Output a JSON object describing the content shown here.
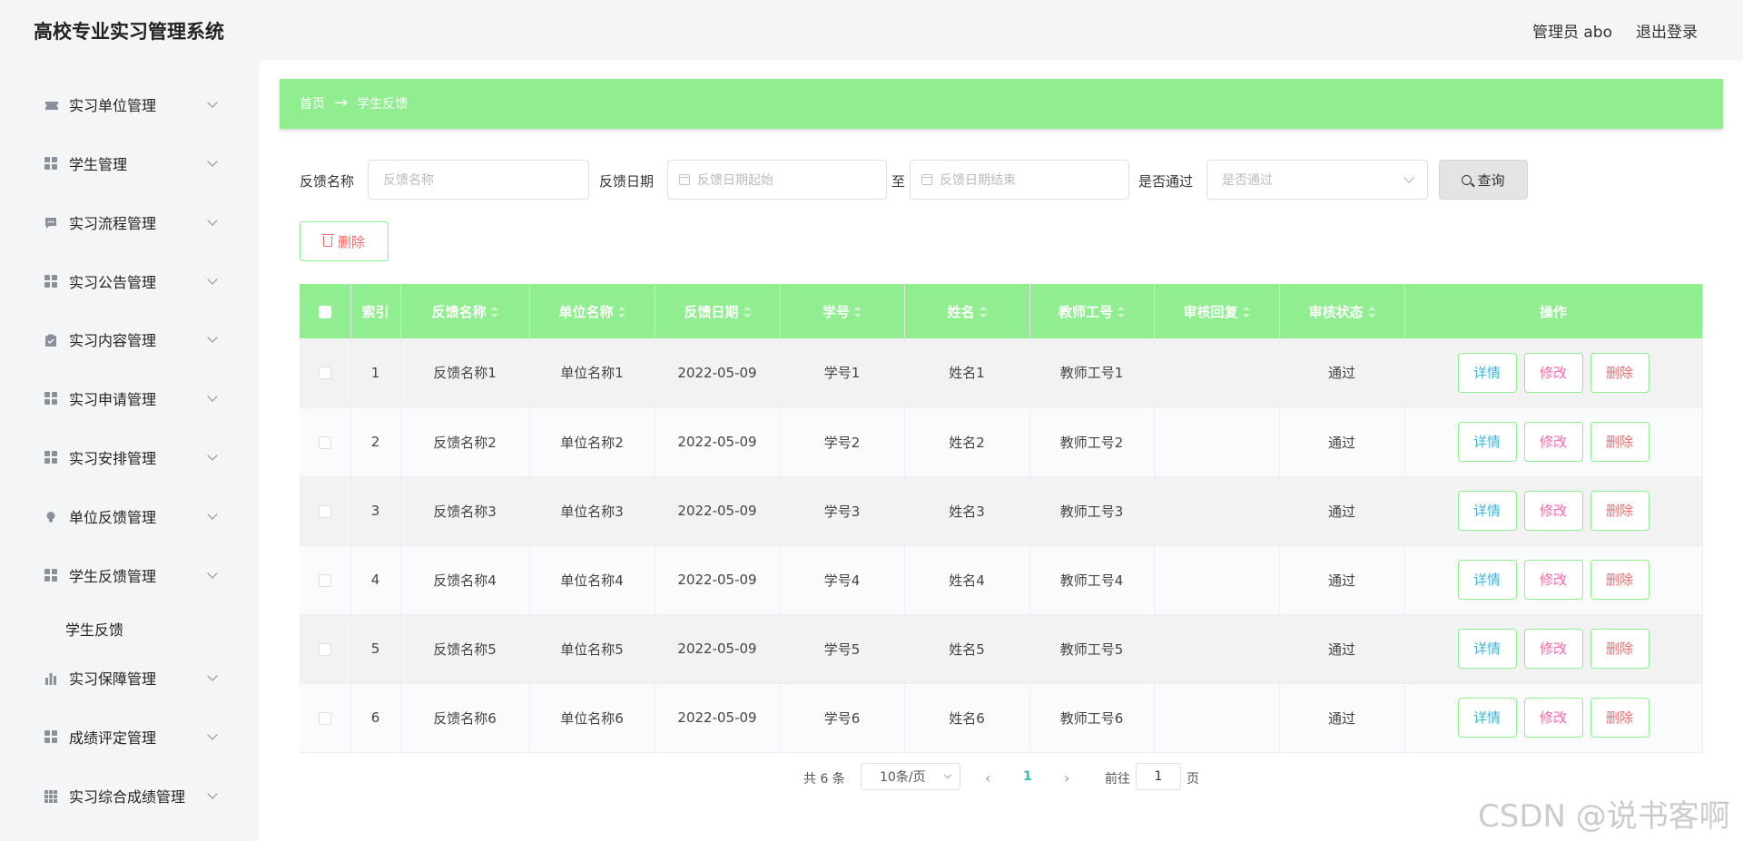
{
  "header": {
    "app_title": "高校专业实习管理系统",
    "user_label": "管理员 abo",
    "logout_label": "退出登录"
  },
  "sidebar": {
    "items": [
      {
        "label": "实习单位管理",
        "icon": "ticket-icon"
      },
      {
        "label": "学生管理",
        "icon": "grid-icon"
      },
      {
        "label": "实习流程管理",
        "icon": "chat-icon"
      },
      {
        "label": "实习公告管理",
        "icon": "grid-icon"
      },
      {
        "label": "实习内容管理",
        "icon": "clipboard-icon"
      },
      {
        "label": "实习申请管理",
        "icon": "grid-icon"
      },
      {
        "label": "实习安排管理",
        "icon": "grid-icon"
      },
      {
        "label": "单位反馈管理",
        "icon": "bulb-icon"
      },
      {
        "label": "学生反馈管理",
        "icon": "grid-icon"
      },
      {
        "label": "实习保障管理",
        "icon": "bar-chart-icon"
      },
      {
        "label": "成绩评定管理",
        "icon": "grid-icon"
      },
      {
        "label": "实习综合成绩管理",
        "icon": "grid-9-icon"
      }
    ],
    "sub_item": "学生反馈"
  },
  "breadcrumb": {
    "home": "首页",
    "arrow": "→",
    "current": "学生反馈"
  },
  "search": {
    "name_label": "反馈名称",
    "name_placeholder": "反馈名称",
    "date_label": "反馈日期",
    "date_start_placeholder": "反馈日期起始",
    "to_label": "至",
    "date_end_placeholder": "反馈日期结束",
    "pass_label": "是否通过",
    "pass_placeholder": "是否通过",
    "query_button": "查询"
  },
  "toolbar": {
    "delete_button": "删除"
  },
  "table": {
    "columns": [
      "索引",
      "反馈名称",
      "单位名称",
      "反馈日期",
      "学号",
      "姓名",
      "教师工号",
      "审核回复",
      "审核状态",
      "操作"
    ],
    "rows": [
      {
        "index": "1",
        "name": "反馈名称1",
        "unit": "单位名称1",
        "date": "2022-05-09",
        "student_no": "学号1",
        "student_name": "姓名1",
        "teacher_no": "教师工号1",
        "reply": "",
        "status": "通过"
      },
      {
        "index": "2",
        "name": "反馈名称2",
        "unit": "单位名称2",
        "date": "2022-05-09",
        "student_no": "学号2",
        "student_name": "姓名2",
        "teacher_no": "教师工号2",
        "reply": "",
        "status": "通过"
      },
      {
        "index": "3",
        "name": "反馈名称3",
        "unit": "单位名称3",
        "date": "2022-05-09",
        "student_no": "学号3",
        "student_name": "姓名3",
        "teacher_no": "教师工号3",
        "reply": "",
        "status": "通过"
      },
      {
        "index": "4",
        "name": "反馈名称4",
        "unit": "单位名称4",
        "date": "2022-05-09",
        "student_no": "学号4",
        "student_name": "姓名4",
        "teacher_no": "教师工号4",
        "reply": "",
        "status": "通过"
      },
      {
        "index": "5",
        "name": "反馈名称5",
        "unit": "单位名称5",
        "date": "2022-05-09",
        "student_no": "学号5",
        "student_name": "姓名5",
        "teacher_no": "教师工号5",
        "reply": "",
        "status": "通过"
      },
      {
        "index": "6",
        "name": "反馈名称6",
        "unit": "单位名称6",
        "date": "2022-05-09",
        "student_no": "学号6",
        "student_name": "姓名6",
        "teacher_no": "教师工号6",
        "reply": "",
        "status": "通过"
      }
    ],
    "actions": {
      "detail": "详情",
      "edit": "修改",
      "delete": "删除"
    }
  },
  "pagination": {
    "total": "共 6 条",
    "page_size": "10条/页",
    "prev": "‹",
    "current_page": "1",
    "next": "›",
    "goto_label": "前往",
    "goto_value": "1",
    "goto_suffix": "页"
  },
  "watermark": "CSDN @说书客啊",
  "colors": {
    "accent_green": "#90ee90",
    "detail": "#41b4d6",
    "edit": "#f56cab",
    "delete": "#f56c6c",
    "active_page": "#2ec4b6"
  }
}
